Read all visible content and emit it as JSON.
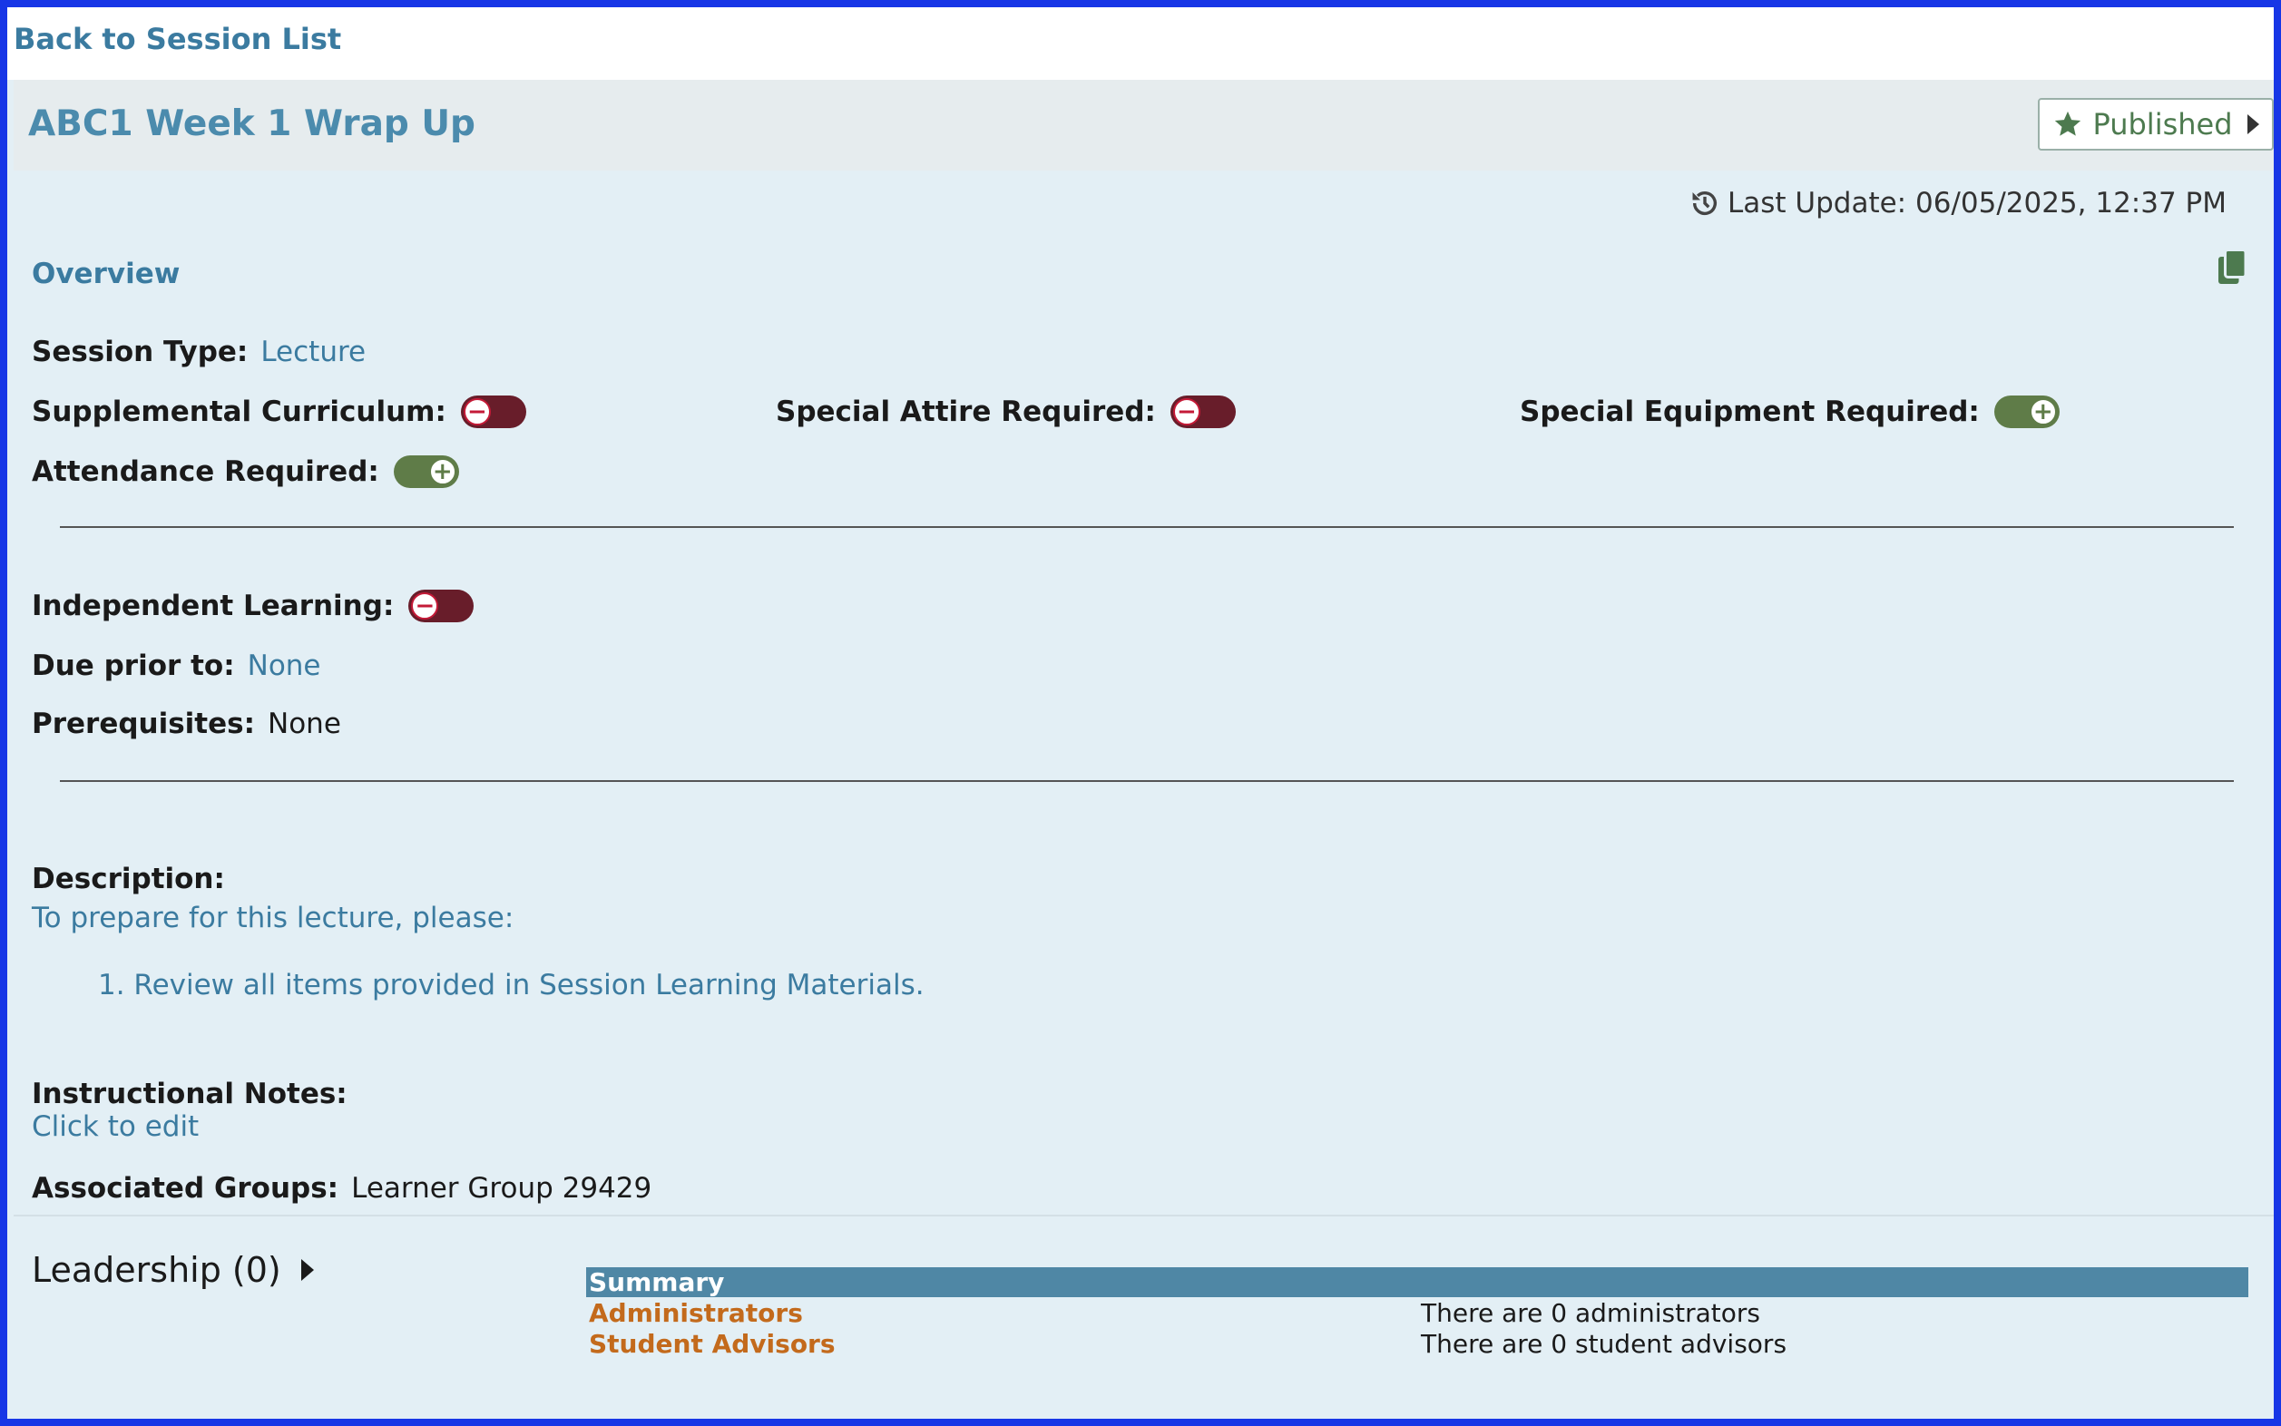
{
  "nav": {
    "back_label": "Back to Session List"
  },
  "header": {
    "title": "ABC1 Week 1 Wrap Up",
    "publish_label": "Published"
  },
  "meta": {
    "last_update": "Last Update: 06/05/2025, 12:37 PM"
  },
  "overview": {
    "title": "Overview",
    "session_type_label": "Session Type:",
    "session_type_value": "Lecture",
    "supplemental_label": "Supplemental Curriculum:",
    "supplemental_on": false,
    "attire_label": "Special Attire Required:",
    "attire_on": false,
    "equipment_label": "Special Equipment Required:",
    "equipment_on": true,
    "attendance_label": "Attendance Required:",
    "attendance_on": true,
    "independent_label": "Independent Learning:",
    "independent_on": false,
    "due_label": "Due prior to:",
    "due_value": "None",
    "prereq_label": "Prerequisites:",
    "prereq_value": "None",
    "description_label": "Description:",
    "description_intro": "To prepare for this lecture, please:",
    "description_item": "1. Review all items provided in Session Learning Materials.",
    "notes_label": "Instructional Notes:",
    "notes_value": "Click to edit",
    "groups_label": "Associated Groups:",
    "groups_value": "Learner Group 29429"
  },
  "leadership": {
    "title": "Leadership (0)",
    "summary_header": "Summary",
    "rows": [
      {
        "name": "Administrators",
        "info": "There are 0 administrators"
      },
      {
        "name": "Student Advisors",
        "info": "There are 0 student advisors"
      }
    ]
  },
  "colors": {
    "border": "#1736e6",
    "panel_bg": "#e3eff5",
    "link": "#3b7ba0",
    "toggle_off": "#681d2a",
    "toggle_on": "#5f7c48",
    "summary_header": "#4f87a5",
    "leader_name": "#c36a1c"
  }
}
